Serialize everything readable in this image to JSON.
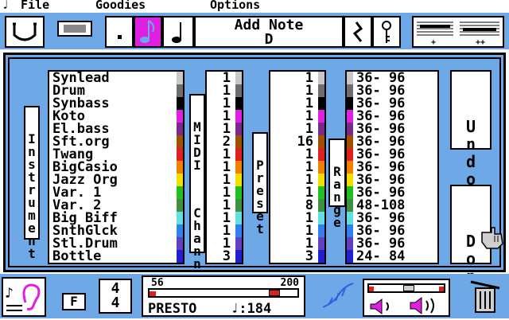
{
  "menu": {
    "file": "File",
    "goodies": "Goodies",
    "options": "Options"
  },
  "toolbar": {
    "add_note_title": "Add Note",
    "add_note_value": "D"
  },
  "labels": {
    "instrument": "Instrument",
    "midi": "MIDI",
    "channel": "Channel",
    "preset": "Preset",
    "range": "Range"
  },
  "instruments": [
    "Synlead",
    "Drum",
    "Synbass",
    "Koto",
    "El.bass",
    "Sft.org",
    "Twang",
    "BigCasio",
    "Jazz Org",
    "Var. 1",
    "Var. 2",
    "Big Biff",
    "SnthGlck",
    "Stl.Drum",
    "Bottle"
  ],
  "channels": [
    "1",
    "1",
    "1",
    "1",
    "1",
    "2",
    "1",
    "1",
    "1",
    "1",
    "1",
    "1",
    "1",
    "1",
    "3"
  ],
  "presets": [
    "1",
    "1",
    "1",
    "1",
    "1",
    "16",
    "1",
    "1",
    "1",
    "1",
    "8",
    "1",
    "1",
    "1",
    "3"
  ],
  "ranges": [
    "36- 96",
    "36- 96",
    "36- 96",
    "36- 96",
    "36- 96",
    "36- 96",
    "36- 96",
    "36- 96",
    "36- 96",
    "36- 96",
    "48-108",
    "36- 96",
    "36- 96",
    "36- 96",
    "24- 84"
  ],
  "strip_colors": [
    "#c8c8c8",
    "#6e6e6e",
    "#000000",
    "#e020e0",
    "#7a2a8a",
    "#a05000",
    "#e02020",
    "#f08000",
    "#f0e000",
    "#20c020",
    "#409040",
    "#60e0e0",
    "#3080f0",
    "#6040c0",
    "#2020d0"
  ],
  "buttons": {
    "undo": "Undo",
    "done": "Done"
  },
  "bottom": {
    "key": "F",
    "time_sig_top": "4",
    "time_sig_bottom": "4",
    "tempo_min": "56",
    "tempo_max": "200",
    "tempo_name": "PRESTO",
    "tempo_value": "♩:184",
    "tempo_fraction": 0.88,
    "volume_fraction": 0.55
  },
  "colors": {
    "background_blue": "#6ea8e6",
    "selected_note": "#e020e0",
    "marker_red": "#e02020"
  },
  "icons": [
    "apple-icon",
    "face-icon",
    "stop-icon",
    "dot-icon",
    "eighth-note-icon",
    "quarter-note-icon",
    "rest-icon",
    "key-icon",
    "staff-icon",
    "ear-icon",
    "quill-icon",
    "speaker-low-icon",
    "speaker-high-icon",
    "trash-icon",
    "hand-pointer-icon"
  ]
}
